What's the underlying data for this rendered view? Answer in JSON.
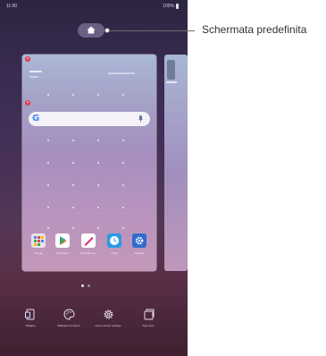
{
  "status_bar": {
    "time": "11:00",
    "battery": "100%"
  },
  "callout": {
    "label": "Schermata predefinita"
  },
  "home_screen": {
    "widget_line1": "11:00",
    "widget_line2": "Mon, 1 Jan",
    "widget_right": "Tap to add weather"
  },
  "search": {
    "engine_letter": "G"
  },
  "dock_apps": [
    {
      "label": "Google",
      "icon": "google-folder-icon",
      "color": "#e8e4ea"
    },
    {
      "label": "Play Store",
      "icon": "play-store-icon",
      "color": "#ffffff"
    },
    {
      "label": "QuickMemo+",
      "icon": "quickmemo-icon",
      "color": "#ffffff"
    },
    {
      "label": "Clock",
      "icon": "clock-icon",
      "color": "#2b9be3"
    },
    {
      "label": "Settings",
      "icon": "settings-icon",
      "color": "#2f6bd0"
    }
  ],
  "bottom_actions": [
    {
      "label": "Widgets",
      "icon": "widgets-icon"
    },
    {
      "label": "Wallpaper & theme",
      "icon": "palette-icon"
    },
    {
      "label": "Home screen settings",
      "icon": "gear-icon"
    },
    {
      "label": "App trays",
      "icon": "app-tray-icon"
    }
  ],
  "colors": {
    "accent_remove": "#e0394a",
    "phone_background": "#3a2c52"
  }
}
